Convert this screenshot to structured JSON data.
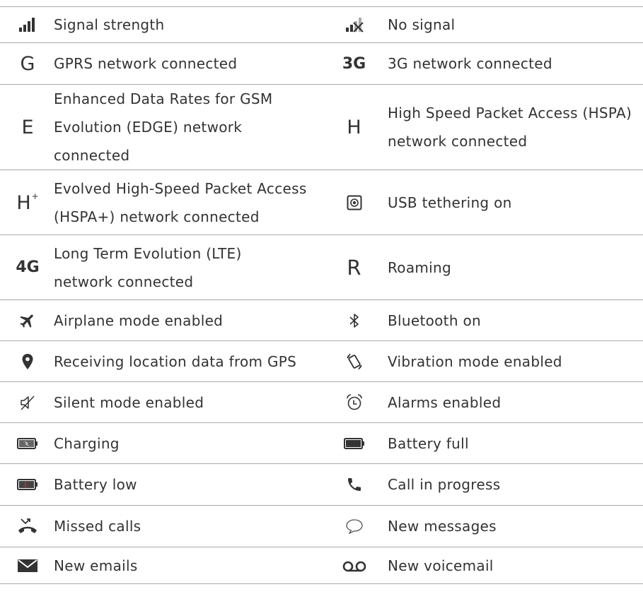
{
  "glyphs": {
    "gprs": "G",
    "g3": "3G",
    "edge": "E",
    "hspa": "H",
    "hspa_plus_base": "H",
    "hspa_plus_sup": "+",
    "lte": "4G",
    "roaming": "R"
  },
  "rows": [
    {
      "left": {
        "icon": "signal-strength-icon",
        "label": "Signal strength"
      },
      "right": {
        "icon": "no-signal-icon",
        "label": "No signal"
      }
    },
    {
      "left": {
        "icon": "gprs-icon",
        "label": "GPRS network connected"
      },
      "right": {
        "icon": "3g-icon",
        "label": "3G network connected"
      }
    },
    {
      "left": {
        "icon": "edge-icon",
        "label": "Enhanced Data Rates for GSM Evolution (EDGE) network connected"
      },
      "right": {
        "icon": "hspa-icon",
        "label": "High Speed Packet Access (HSPA) network connected"
      }
    },
    {
      "left": {
        "icon": "hspa-plus-icon",
        "label": "Evolved High-Speed Packet Access (HSPA+) network connected"
      },
      "right": {
        "icon": "usb-tethering-icon",
        "label": "USB tethering on"
      }
    },
    {
      "left": {
        "icon": "lte-icon",
        "label": "Long Term Evolution (LTE) network connected"
      },
      "right": {
        "icon": "roaming-icon",
        "label": "Roaming"
      }
    },
    {
      "left": {
        "icon": "airplane-icon",
        "label": "Airplane mode enabled"
      },
      "right": {
        "icon": "bluetooth-icon",
        "label": "Bluetooth on"
      }
    },
    {
      "left": {
        "icon": "location-pin-icon",
        "label": "Receiving location data from GPS"
      },
      "right": {
        "icon": "vibration-icon",
        "label": "Vibration mode enabled"
      }
    },
    {
      "left": {
        "icon": "silent-mode-icon",
        "label": "Silent mode enabled"
      },
      "right": {
        "icon": "alarm-icon",
        "label": "Alarms enabled"
      }
    },
    {
      "left": {
        "icon": "battery-charging-icon",
        "label": "Charging"
      },
      "right": {
        "icon": "battery-full-icon",
        "label": "Battery full"
      }
    },
    {
      "left": {
        "icon": "battery-low-icon",
        "label": "Battery low"
      },
      "right": {
        "icon": "phone-call-icon",
        "label": "Call in progress"
      }
    },
    {
      "left": {
        "icon": "missed-call-icon",
        "label": "Missed calls"
      },
      "right": {
        "icon": "message-bubble-icon",
        "label": "New messages"
      }
    },
    {
      "left": {
        "icon": "email-envelope-icon",
        "label": "New emails"
      },
      "right": {
        "icon": "voicemail-icon",
        "label": "New voicemail"
      }
    }
  ],
  "colors": {
    "rule": "#a9a9a9",
    "text": "#333333",
    "battery_low_red": "#d42020"
  }
}
